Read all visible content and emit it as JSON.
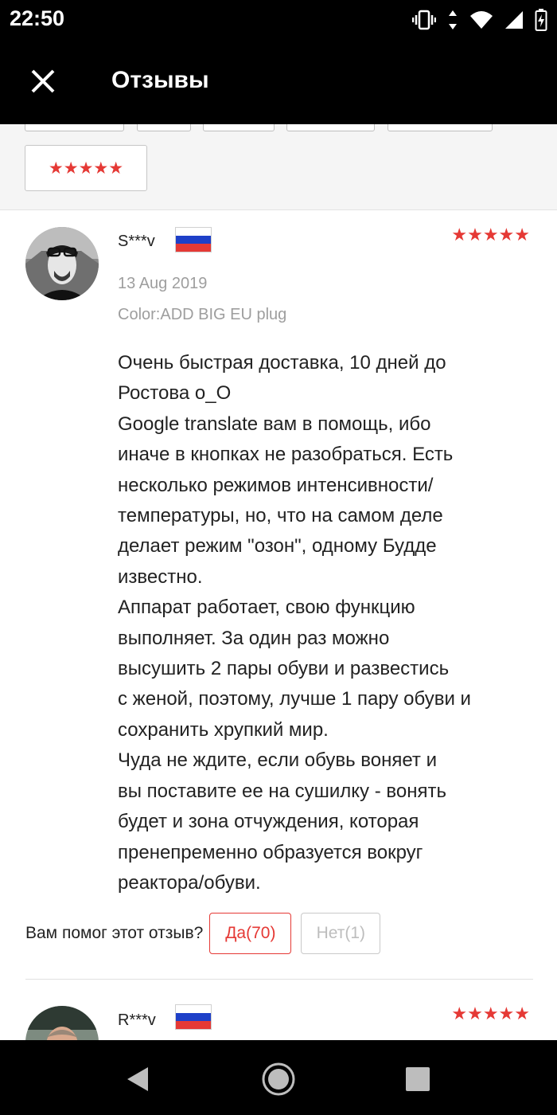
{
  "status_bar": {
    "time": "22:50",
    "icons": [
      "vibrate-icon",
      "data-arrows-icon",
      "wifi-icon",
      "signal-icon",
      "battery-charging-icon"
    ]
  },
  "app_bar": {
    "title": "Отзывы",
    "close_icon": "close-icon"
  },
  "filters": {
    "active_filter_stars": "★★★★★"
  },
  "reviews": [
    {
      "author": "S***v",
      "country_flag": "russia-flag",
      "stars": "★★★★★",
      "rating": 5,
      "date": "13 Aug 2019",
      "variant": "Color:ADD BIG EU plug",
      "text": "Очень быстрая доставка, 10 дней до\nРостова о_О\nGoogle translate вам в помощь, ибо\nиначе в кнопках не разобраться. Есть\nнесколько режимов интенсивности/\nтемпературы, но, что на самом деле\nделает режим \"озон\", одному Будде\nизвестно.\nАппарат работает, свою функцию\nвыполняет. За один раз можно\nвысушить 2 пары обуви и развестись\nс женой, поэтому, лучше 1 пару обуви и\nсохранить хрупкий мир.\nЧуда не ждите, если обувь воняет и\nвы поставите ее на сушилку - вонять\nбудет и зона отчуждения, которая\nпренепременно образуется вокруг\nреактора/обуви.",
      "helpful_question": "Вам помог этот отзыв?",
      "yes_label": "Да(70)",
      "no_label": "Нет(1)"
    },
    {
      "author": "R***v",
      "country_flag": "russia-flag",
      "stars": "★★★★★",
      "rating": 5
    }
  ],
  "colors": {
    "accent": "#e53935",
    "muted_text": "#9e9e9e",
    "bar_background": "#000000"
  }
}
